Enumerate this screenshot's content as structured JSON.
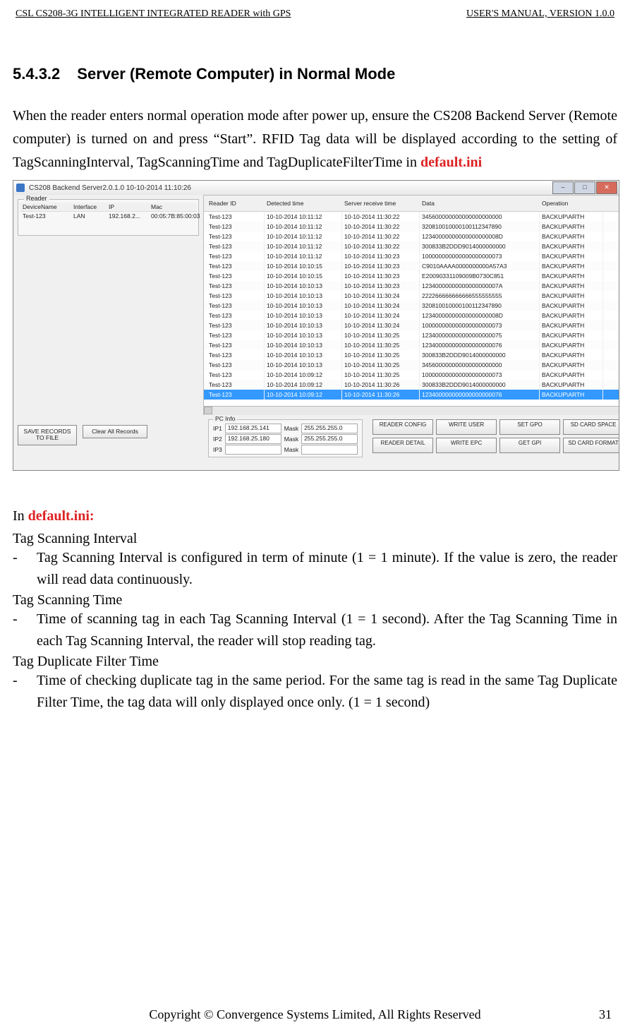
{
  "header": {
    "left": "CSL CS208-3G INTELLIGENT INTEGRATED READER with GPS",
    "right": "USER'S  MANUAL,  VERSION  1.0.0"
  },
  "section": {
    "number": "5.4.3.2",
    "title": "Server (Remote Computer) in Normal Mode"
  },
  "paragraph1_a": "When the reader enters normal operation mode after power up, ensure the CS208 Backend Server (Remote computer) is turned on and press “Start”.   RFID Tag data will be displayed according to the setting of TagScanningInterval, TagScanningTime and TagDuplicateFilterTime in ",
  "default_ini": "default.ini",
  "screenshot": {
    "title": "CS208 Backend Server2.0.1.0  10-10-2014 11:10:26",
    "win_min": "–",
    "win_max": "□",
    "win_close": "✕",
    "reader_group_label": "Reader",
    "reader_head": {
      "c1": "DeviceName",
      "c2": "Interface",
      "c3": "IP",
      "c4": "Mac"
    },
    "reader_row": {
      "c1": "Test-123",
      "c2": "LAN",
      "c3": "192.168.2...",
      "c4": "00:05:7B:85:00:03"
    },
    "tag_head": {
      "c1": "Reader ID",
      "c2": "Detected time",
      "c3": "Server receive time",
      "c4": "Data",
      "c5": "Operation"
    },
    "rows": [
      {
        "id": "Test-123",
        "d": "10-10-2014 10:11:12",
        "r": "10-10-2014 11:30:22",
        "data": "345600000000000000000000",
        "op": "BACKUP\\ARTH"
      },
      {
        "id": "Test-123",
        "d": "10-10-2014 10:11:12",
        "r": "10-10-2014 11:30:22",
        "data": "320810010000100112347890",
        "op": "BACKUP\\ARTH"
      },
      {
        "id": "Test-123",
        "d": "10-10-2014 10:11:12",
        "r": "10-10-2014 11:30:22",
        "data": "12340000000000000000008D",
        "op": "BACKUP\\ARTH"
      },
      {
        "id": "Test-123",
        "d": "10-10-2014 10:11:12",
        "r": "10-10-2014 11:30:22",
        "data": "300833B2DDD9014000000000",
        "op": "BACKUP\\ARTH"
      },
      {
        "id": "Test-123",
        "d": "10-10-2014 10:11:12",
        "r": "10-10-2014 11:30:23",
        "data": "100000000000000000000073",
        "op": "BACKUP\\ARTH"
      },
      {
        "id": "Test-123",
        "d": "10-10-2014 10:10:15",
        "r": "10-10-2014 11:30:23",
        "data": "C9010AAAA0000000000A57A3",
        "op": "BACKUP\\ARTH"
      },
      {
        "id": "Test-123",
        "d": "10-10-2014 10:10:15",
        "r": "10-10-2014 11:30:23",
        "data": "E20090331109009B0730C851",
        "op": "BACKUP\\ARTH"
      },
      {
        "id": "Test-123",
        "d": "10-10-2014 10:10:13",
        "r": "10-10-2014 11:30:23",
        "data": "12340000000000000000007A",
        "op": "BACKUP\\ARTH"
      },
      {
        "id": "Test-123",
        "d": "10-10-2014 10:10:13",
        "r": "10-10-2014 11:30:24",
        "data": "222266666666666555555555",
        "op": "BACKUP\\ARTH"
      },
      {
        "id": "Test-123",
        "d": "10-10-2014 10:10:13",
        "r": "10-10-2014 11:30:24",
        "data": "320810010000100112347890",
        "op": "BACKUP\\ARTH"
      },
      {
        "id": "Test-123",
        "d": "10-10-2014 10:10:13",
        "r": "10-10-2014 11:30:24",
        "data": "12340000000000000000008D",
        "op": "BACKUP\\ARTH"
      },
      {
        "id": "Test-123",
        "d": "10-10-2014 10:10:13",
        "r": "10-10-2014 11:30:24",
        "data": "100000000000000000000073",
        "op": "BACKUP\\ARTH"
      },
      {
        "id": "Test-123",
        "d": "10-10-2014 10:10:13",
        "r": "10-10-2014 11:30:25",
        "data": "123400000000000000000075",
        "op": "BACKUP\\ARTH"
      },
      {
        "id": "Test-123",
        "d": "10-10-2014 10:10:13",
        "r": "10-10-2014 11:30:25",
        "data": "123400000000000000000076",
        "op": "BACKUP\\ARTH"
      },
      {
        "id": "Test-123",
        "d": "10-10-2014 10:10:13",
        "r": "10-10-2014 11:30:25",
        "data": "300833B2DDD9014000000000",
        "op": "BACKUP\\ARTH"
      },
      {
        "id": "Test-123",
        "d": "10-10-2014 10:10:13",
        "r": "10-10-2014 11:30:25",
        "data": "345600000000000000000000",
        "op": "BACKUP\\ARTH"
      },
      {
        "id": "Test-123",
        "d": "10-10-2014 10:09:12",
        "r": "10-10-2014 11:30:25",
        "data": "100000000000000000000073",
        "op": "BACKUP\\ARTH"
      },
      {
        "id": "Test-123",
        "d": "10-10-2014 10:09:12",
        "r": "10-10-2014 11:30:26",
        "data": "300833B2DDD9014000000000",
        "op": "BACKUP\\ARTH"
      },
      {
        "id": "Test-123",
        "d": "10-10-2014 10:09:12",
        "r": "10-10-2014 11:30:26",
        "data": "123400000000000000000076",
        "op": "BACKUP\\ARTH"
      }
    ],
    "btn_save_records": "SAVE RECORDS TO FILE",
    "btn_clear_all": "Clear All Records",
    "pc_info_label": "PC Info",
    "pc": {
      "ip1_l": "IP1",
      "ip1": "192.168.25.141",
      "mask1_l": "Mask",
      "mask1": "255.255.255.0",
      "ip2_l": "IP2",
      "ip2": "192.168.25.180",
      "mask2_l": "Mask",
      "mask2": "255.255.255.0",
      "ip3_l": "IP3",
      "ip3": "",
      "mask3_l": "Mask",
      "mask3": ""
    },
    "actions": {
      "reader_config": "READER CONFIG",
      "write_user": "WRITE USER",
      "set_gpo": "SET GPO",
      "sd_space": "SD CARD SPACE",
      "reader_detail": "READER DETAIL",
      "write_epc": "WRITE EPC",
      "get_gpi": "GET GPI",
      "sd_format": "SD CARD FORMAT"
    }
  },
  "body": {
    "in_prefix": "In ",
    "default_ini_colon": "default.ini:",
    "term1": "Tag Scanning Interval",
    "bullet1": "Tag Scanning Interval is configured in term of minute (1 = 1 minute). If the value is zero, the reader will read data continuously.",
    "term2": "Tag Scanning Time",
    "bullet2": "Time of scanning tag in each Tag Scanning Interval (1 = 1 second). After the Tag Scanning Time in each Tag Scanning Interval, the reader will stop reading tag.",
    "term3": "Tag Duplicate Filter Time",
    "bullet3": "Time of checking duplicate tag in the same period. For the same tag is read in the same Tag Duplicate Filter Time, the tag data will only displayed once only. (1 = 1 second)"
  },
  "footer": {
    "text": "Copyright © Convergence Systems Limited, All Rights Reserved",
    "page": "31"
  }
}
